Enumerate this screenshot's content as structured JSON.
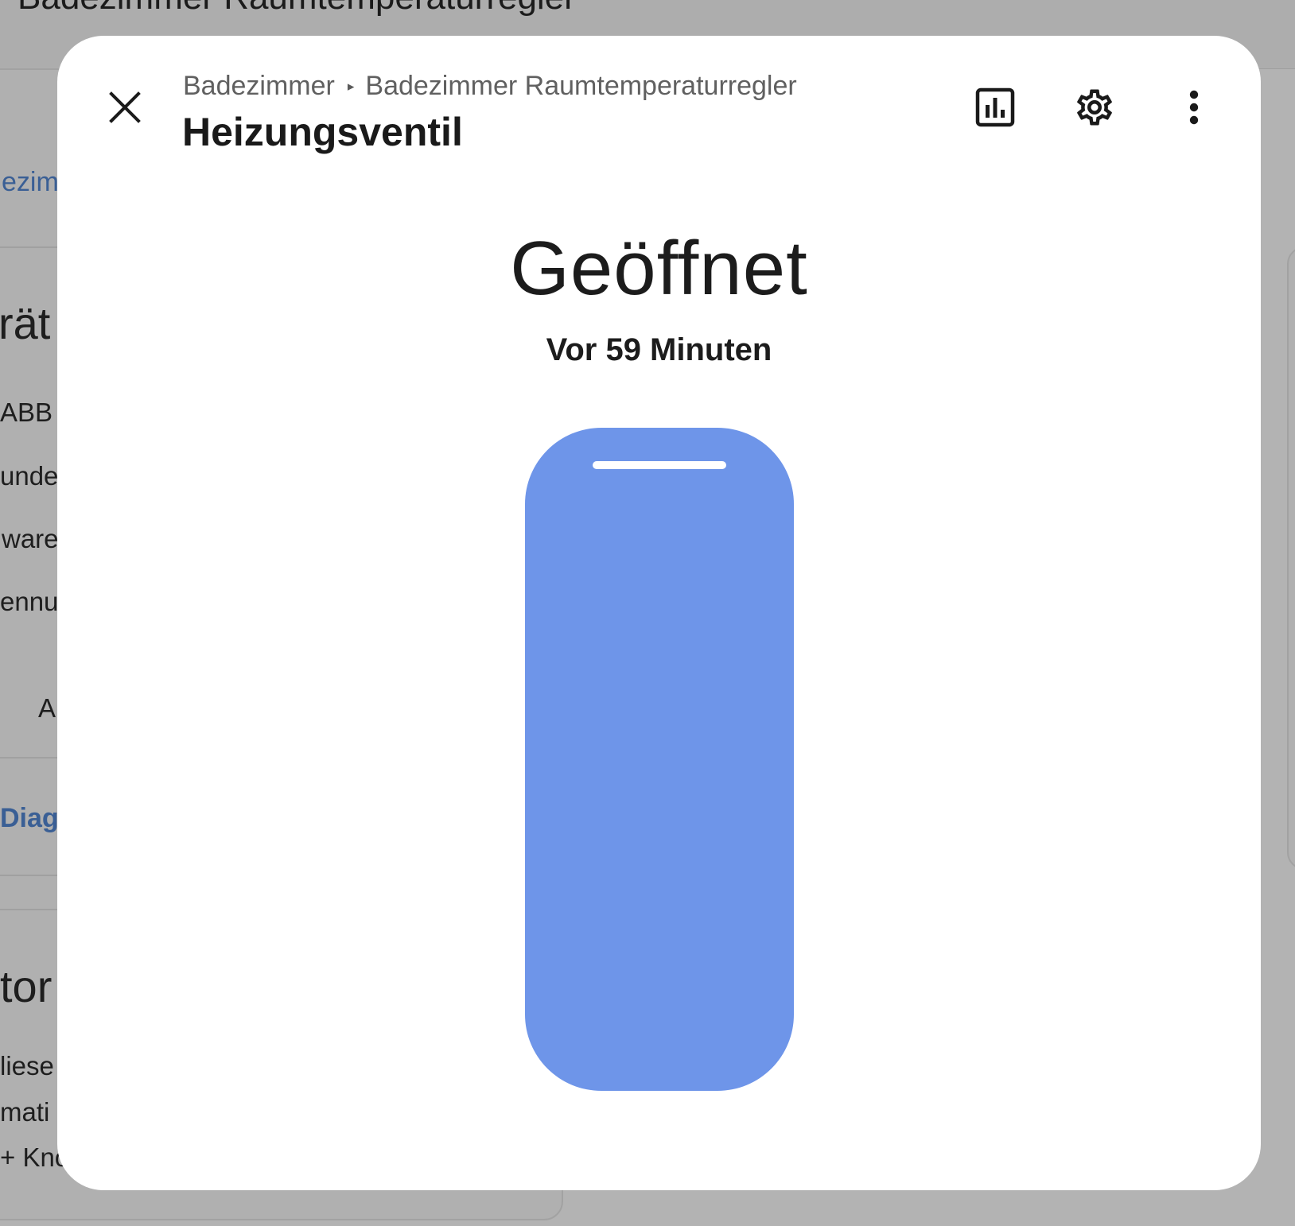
{
  "background": {
    "page_title": "Badezimmer Raumtemperaturregler",
    "fragments": [
      {
        "id": "area",
        "text": "ezim"
      },
      {
        "id": "device_heading",
        "text": "rät"
      },
      {
        "id": "manufacturer",
        "text": "ABB"
      },
      {
        "id": "row2",
        "text": "unde"
      },
      {
        "id": "row3",
        "text": "ware"
      },
      {
        "id": "row4",
        "text": "ennu"
      },
      {
        "id": "row5",
        "text": "A"
      },
      {
        "id": "diagnostics_link",
        "text": "Diagr"
      },
      {
        "id": "section_heading",
        "text": "tor"
      },
      {
        "id": "desc1",
        "text": "liese"
      },
      {
        "id": "desc2",
        "text": "mati"
      },
      {
        "id": "desc3",
        "text": "+ Kno"
      }
    ]
  },
  "dialog": {
    "close_icon": "close-icon",
    "breadcrumb": {
      "area": "Badezimmer",
      "separator": "▸",
      "device": "Badezimmer Raumtemperaturregler"
    },
    "title": "Heizungsventil",
    "actions": [
      {
        "name": "history",
        "icon": "chart-bar-icon"
      },
      {
        "name": "settings",
        "icon": "gear-icon"
      },
      {
        "name": "more",
        "icon": "more-vertical-icon"
      }
    ],
    "state": "Geöffnet",
    "last_changed": "Vor 59 Minuten",
    "valve": {
      "open": true,
      "color": "#6e95e9"
    }
  }
}
